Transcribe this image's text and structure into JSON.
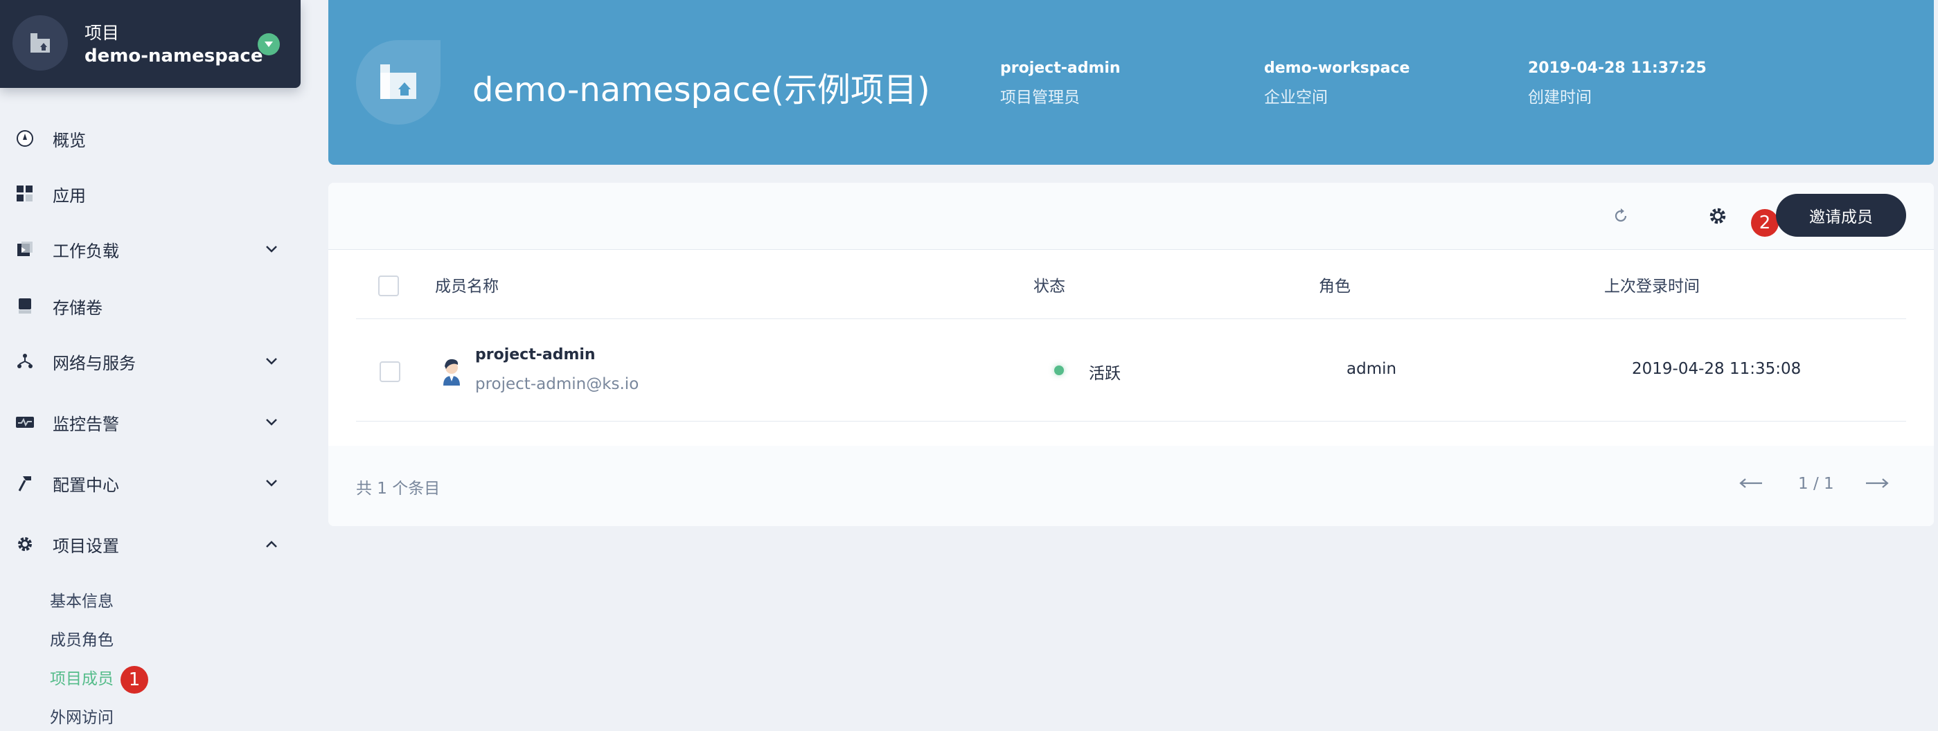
{
  "project": {
    "kind": "项目",
    "name": "demo-namespace"
  },
  "nav": [
    {
      "label": "概览",
      "icon": "dashboard-icon"
    },
    {
      "label": "应用",
      "icon": "apps-grid-icon"
    },
    {
      "label": "工作负载",
      "icon": "workload-icon",
      "expandable": true
    },
    {
      "label": "存储卷",
      "icon": "storage-icon"
    },
    {
      "label": "网络与服务",
      "icon": "network-icon",
      "expandable": true
    },
    {
      "label": "监控告警",
      "icon": "monitor-icon",
      "expandable": true
    },
    {
      "label": "配置中心",
      "icon": "config-hammer-icon",
      "expandable": true
    },
    {
      "label": "项目设置",
      "icon": "gear-icon",
      "expandable": true,
      "expanded": true
    }
  ],
  "settings_sub": [
    "基本信息",
    "成员角色",
    "项目成员",
    "外网访问"
  ],
  "badges": {
    "one": "1",
    "two": "2"
  },
  "banner": {
    "title": "demo-namespace(示例项目)",
    "meta": [
      {
        "value": "project-admin",
        "label": "项目管理员"
      },
      {
        "value": "demo-workspace",
        "label": "企业空间"
      },
      {
        "value": "2019-04-28 11:37:25",
        "label": "创建时间"
      }
    ]
  },
  "toolbar": {
    "invite_label": "邀请成员"
  },
  "table": {
    "columns": [
      "成员名称",
      "状态",
      "角色",
      "上次登录时间"
    ],
    "rows": [
      {
        "name": "project-admin",
        "email": "project-admin@ks.io",
        "status": "活跃",
        "role": "admin",
        "last_login": "2019-04-28 11:35:08"
      }
    ]
  },
  "footer": {
    "total": "共 1 个条目",
    "page": "1 / 1"
  },
  "colors": {
    "sidebar_dark": "#242e42",
    "banner": "#4f9dca",
    "active_green": "#55bc8a",
    "badge_red": "#d82c26"
  }
}
